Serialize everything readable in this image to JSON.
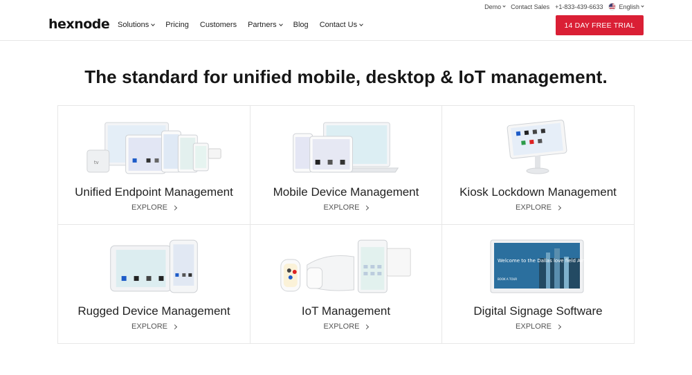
{
  "brand": {
    "logo_text": "hexnode",
    "accent_color": "#da1f35"
  },
  "topbar": {
    "demo": "Demo",
    "contact_sales": "Contact Sales",
    "phone": "+1-833-439-6633",
    "language": "English"
  },
  "nav": {
    "items": [
      {
        "label": "Solutions",
        "dropdown": true
      },
      {
        "label": "Pricing",
        "dropdown": false
      },
      {
        "label": "Customers",
        "dropdown": false
      },
      {
        "label": "Partners",
        "dropdown": true
      },
      {
        "label": "Blog",
        "dropdown": false
      },
      {
        "label": "Contact Us",
        "dropdown": true
      }
    ]
  },
  "cta": {
    "label": "14 DAY FREE TRIAL"
  },
  "hero": {
    "title": "The standard for unified mobile, desktop & IoT management."
  },
  "cards": [
    {
      "title": "Unified Endpoint Management",
      "explore": "EXPLORE",
      "art": "devices-ecosystem-image"
    },
    {
      "title": "Mobile Device Management",
      "explore": "EXPLORE",
      "art": "tablet-laptop-image"
    },
    {
      "title": "Kiosk Lockdown Management",
      "explore": "EXPLORE",
      "art": "kiosk-tablet-image"
    },
    {
      "title": "Rugged Device Management",
      "explore": "EXPLORE",
      "art": "rugged-devices-image"
    },
    {
      "title": "IoT Management",
      "explore": "EXPLORE",
      "art": "iot-devices-image"
    },
    {
      "title": "Digital Signage Software",
      "explore": "EXPLORE",
      "art": "signage-display-image"
    }
  ],
  "signage": {
    "screen_text": "Welcome to the Dallas love field Airport",
    "small_text": "BOOK A TOUR"
  }
}
